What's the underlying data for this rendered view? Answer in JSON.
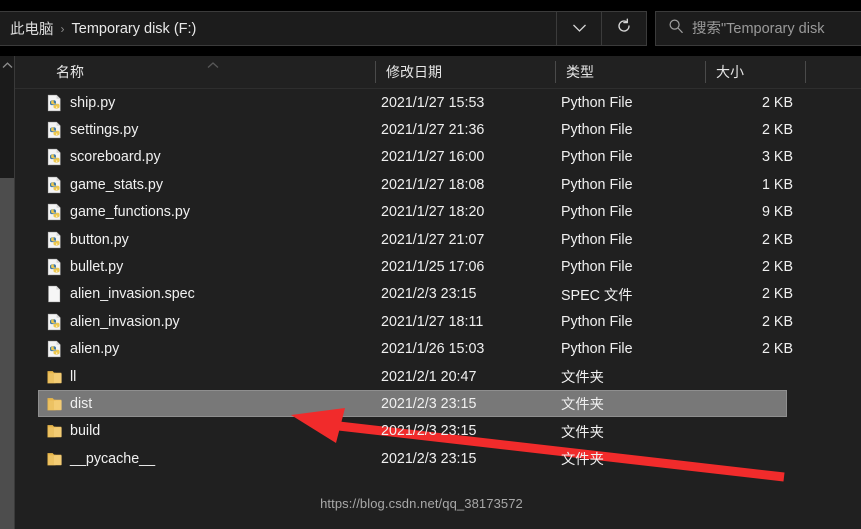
{
  "window": {
    "title": "Temporary disk (F:)"
  },
  "addressbar": {
    "breadcrumbs": [
      "此电脑",
      "Temporary disk (F:)"
    ],
    "separator": "›",
    "chevron_icon": "chevron-down-icon",
    "refresh_icon": "refresh-icon"
  },
  "search": {
    "icon": "search-icon",
    "placeholder": "搜索\"Temporary disk",
    "value": ""
  },
  "columns": [
    {
      "key": "name",
      "label": "名称"
    },
    {
      "key": "date",
      "label": "修改日期"
    },
    {
      "key": "type",
      "label": "类型"
    },
    {
      "key": "size",
      "label": "大小"
    }
  ],
  "sort": {
    "column": "名称",
    "direction": "asc",
    "icon": "chevron-up-icon"
  },
  "files": [
    {
      "name": "ship.py",
      "date": "2021/1/27 15:53",
      "type": "Python File",
      "size": "2 KB",
      "icon": "python-file-icon",
      "selected": false
    },
    {
      "name": "settings.py",
      "date": "2021/1/27 21:36",
      "type": "Python File",
      "size": "2 KB",
      "icon": "python-file-icon",
      "selected": false
    },
    {
      "name": "scoreboard.py",
      "date": "2021/1/27 16:00",
      "type": "Python File",
      "size": "3 KB",
      "icon": "python-file-icon",
      "selected": false
    },
    {
      "name": "game_stats.py",
      "date": "2021/1/27 18:08",
      "type": "Python File",
      "size": "1 KB",
      "icon": "python-file-icon",
      "selected": false
    },
    {
      "name": "game_functions.py",
      "date": "2021/1/27 18:20",
      "type": "Python File",
      "size": "9 KB",
      "icon": "python-file-icon",
      "selected": false
    },
    {
      "name": "button.py",
      "date": "2021/1/27 21:07",
      "type": "Python File",
      "size": "2 KB",
      "icon": "python-file-icon",
      "selected": false
    },
    {
      "name": "bullet.py",
      "date": "2021/1/25 17:06",
      "type": "Python File",
      "size": "2 KB",
      "icon": "python-file-icon",
      "selected": false
    },
    {
      "name": "alien_invasion.spec",
      "date": "2021/2/3 23:15",
      "type": "SPEC 文件",
      "size": "2 KB",
      "icon": "generic-file-icon",
      "selected": false
    },
    {
      "name": "alien_invasion.py",
      "date": "2021/1/27 18:11",
      "type": "Python File",
      "size": "2 KB",
      "icon": "python-file-icon",
      "selected": false
    },
    {
      "name": "alien.py",
      "date": "2021/1/26 15:03",
      "type": "Python File",
      "size": "2 KB",
      "icon": "python-file-icon",
      "selected": false
    },
    {
      "name": "ll",
      "date": "2021/2/1 20:47",
      "type": "文件夹",
      "size": "",
      "icon": "folder-icon",
      "selected": false
    },
    {
      "name": "dist",
      "date": "2021/2/3 23:15",
      "type": "文件夹",
      "size": "",
      "icon": "folder-icon",
      "selected": true
    },
    {
      "name": "build",
      "date": "2021/2/3 23:15",
      "type": "文件夹",
      "size": "",
      "icon": "folder-icon",
      "selected": false
    },
    {
      "name": "__pycache__",
      "date": "2021/2/3 23:15",
      "type": "文件夹",
      "size": "",
      "icon": "folder-icon",
      "selected": false
    }
  ],
  "scrollbar": {
    "up_icon": "chevron-up-icon",
    "orientation": "vertical"
  },
  "annotation": {
    "shape": "red-arrow",
    "color": "#f12b2b",
    "points_to": "dist"
  },
  "watermark": {
    "text": "https://blog.csdn.net/qq_38173572"
  },
  "colors": {
    "background": "#202020",
    "selection": "#787878",
    "text": "#f0f0f0",
    "accent": "#f12b2b"
  }
}
